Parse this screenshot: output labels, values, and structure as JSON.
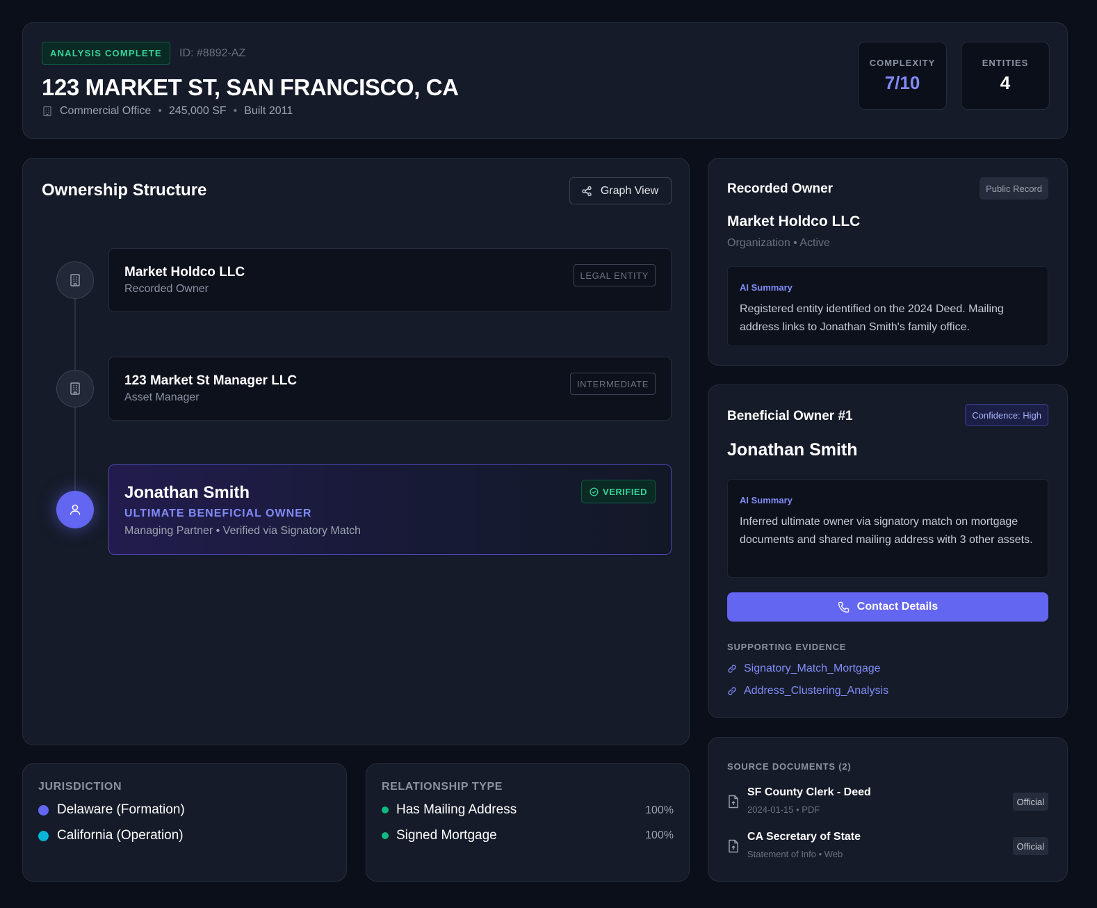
{
  "header": {
    "status": "ANALYSIS COMPLETE",
    "report_id": "ID: #8892-AZ",
    "title": "123 MARKET ST, SAN FRANCISCO, CA",
    "meta": [
      "Commercial Office",
      "245,000 SF",
      "Built 2011"
    ],
    "meta_sep": "•",
    "stats": [
      {
        "label": "COMPLEXITY",
        "value": "7/10",
        "color": "#818cf8"
      },
      {
        "label": "ENTITIES",
        "value": "4",
        "color": "#ffffff"
      }
    ]
  },
  "ownership": {
    "title": "Ownership Structure",
    "graph_button": "Graph View",
    "entities": [
      {
        "name": "Market Holdco LLC",
        "role": "Recorded Owner",
        "tag": "LEGAL ENTITY",
        "icon": "building-icon"
      },
      {
        "name": "123 Market St Manager LLC",
        "role": "Asset Manager",
        "tag": "INTERMEDIATE",
        "icon": "building-icon"
      },
      {
        "name": "Jonathan Smith",
        "subtitle": "ULTIMATE BENEFICIAL OWNER",
        "role": "Managing Partner • Verified via Signatory Match",
        "tag": "VERIFIED",
        "icon": "user-icon"
      }
    ]
  },
  "jurisdiction": {
    "title": "JURISDICTION",
    "items": [
      {
        "label": "Delaware (Formation)",
        "color": "#6366f1"
      },
      {
        "label": "California (Operation)",
        "color": "#06b6d4"
      }
    ]
  },
  "relationship": {
    "title": "RELATIONSHIP TYPE",
    "items": [
      {
        "label": "Has Mailing Address",
        "value": "100%",
        "color": "#10b981"
      },
      {
        "label": "Signed Mortgage",
        "value": "100%",
        "color": "#10b981"
      }
    ]
  },
  "recorded_owner": {
    "title": "Recorded Owner",
    "badge": "Public Record",
    "name": "Market Holdco LLC",
    "meta": "Organization • Active",
    "ai_label": "AI Summary",
    "ai_text": "Registered entity identified on the 2024 Deed. Mailing address links to Jonathan Smith's family office."
  },
  "beneficial_owner": {
    "title": "Beneficial Owner #1",
    "badge": "Confidence: High",
    "name": "Jonathan Smith",
    "ai_label": "AI Summary",
    "ai_text": "Inferred ultimate owner via signatory match on mortgage documents and shared mailing address with 3 other assets.",
    "contact_button": "Contact Details",
    "evidence_title": "SUPPORTING EVIDENCE",
    "evidence": [
      "Signatory_Match_Mortgage",
      "Address_Clustering_Analysis"
    ]
  },
  "source_docs": {
    "title": "SOURCE DOCUMENTS (2)",
    "items": [
      {
        "title": "SF County Clerk - Deed",
        "meta": "2024-01-15 • PDF",
        "badge": "Official"
      },
      {
        "title": "CA Secretary of State",
        "meta": "Statement of Info • Web",
        "badge": "Official"
      }
    ]
  }
}
